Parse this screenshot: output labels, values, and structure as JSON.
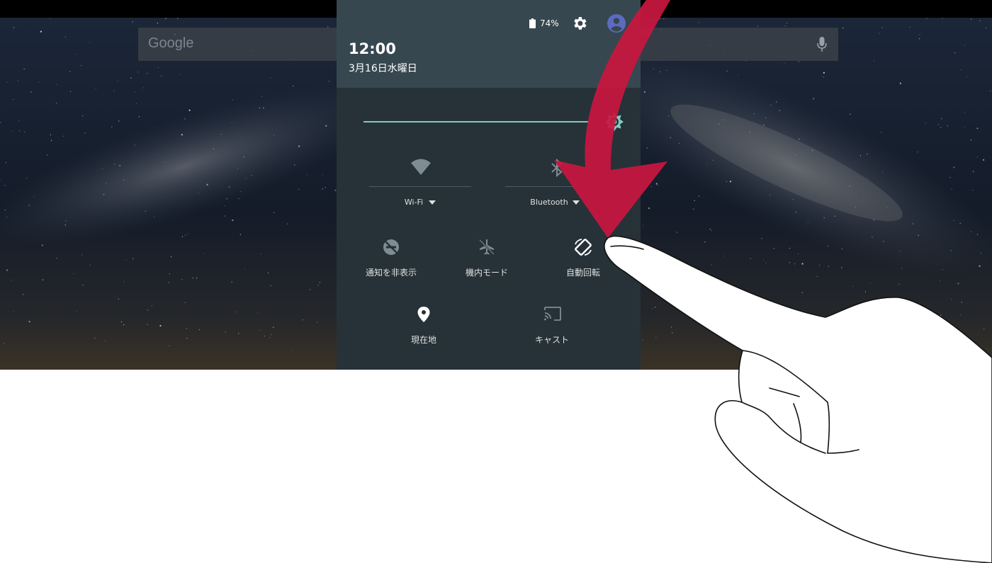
{
  "home": {
    "search_brand": "Google"
  },
  "status": {
    "battery_percent": "74%"
  },
  "header": {
    "time": "12:00",
    "date": "3月16日水曜日"
  },
  "brightness": {
    "level": 0.9
  },
  "tiles": {
    "wifi": {
      "label": "Wi-Fi"
    },
    "bluetooth": {
      "label": "Bluetooth"
    },
    "do_not_disturb": {
      "label": "通知を非表示"
    },
    "airplane": {
      "label": "機内モード"
    },
    "auto_rotate": {
      "label": "自動回転"
    },
    "location": {
      "label": "現在地"
    },
    "cast": {
      "label": "キャスト"
    }
  },
  "colors": {
    "accent": "#80cbc4",
    "shade": "#263238",
    "header": "#37474f",
    "arrow": "#c8173f"
  },
  "icons": [
    "mic-icon",
    "battery-icon",
    "gear-icon",
    "user-icon",
    "brightness-icon",
    "wifi-icon",
    "bluetooth-icon",
    "do-not-disturb-icon",
    "airplane-icon",
    "auto-rotate-icon",
    "location-icon",
    "cast-icon",
    "swipe-down-arrow",
    "hand-gesture"
  ]
}
